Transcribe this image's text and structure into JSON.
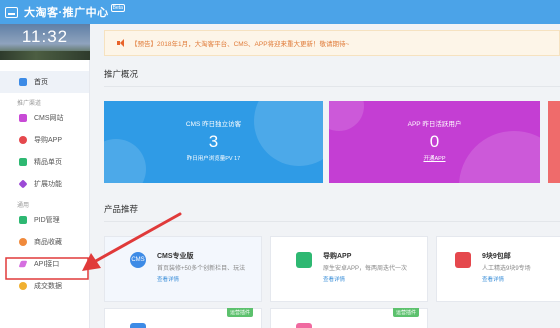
{
  "app": {
    "title": "大淘客·推广中心",
    "badge": "Beta"
  },
  "clock": "11:32",
  "sidebar": {
    "home": "首页",
    "section_promo": "推广渠道",
    "promo_items": [
      "CMS网站",
      "导购APP",
      "精品单页",
      "扩展功能"
    ],
    "section_general": "通用",
    "general_items": [
      "PID管理",
      "商品收藏",
      "API接口",
      "成交数据"
    ]
  },
  "notice": "【预告】2018年1月，大淘客平台、CMS、APP将迎来重大更新！敬请期待~",
  "overview": {
    "title": "推广概况",
    "cms": {
      "label": "CMS 昨日独立访客",
      "value": "3",
      "sub": "昨日用户浏览量PV 17"
    },
    "app": {
      "label": "APP 昨日活跃用户",
      "value": "0",
      "link": "开通APP"
    }
  },
  "products": {
    "title": "产品推荐",
    "items": [
      {
        "name": "CMS专业版",
        "desc": "首页装修+50多个创新栏目、玩法",
        "link": "查看详情",
        "icon": "CMS"
      },
      {
        "name": "导购APP",
        "desc": "原生安卓APP，每两周迭代一次",
        "link": "查看详情",
        "icon": ""
      },
      {
        "name": "9块9包邮",
        "desc": "人工精选9块9专场",
        "link": "查看详情",
        "icon": ""
      }
    ],
    "row2_badges": [
      "运营插件",
      "运营插件"
    ]
  },
  "colors": {
    "topbar": "#4ba3e8",
    "cms_card": "#2f9be6",
    "app_card": "#c43ed3",
    "notice_text": "#e07b39",
    "arrow": "#e03a3a"
  }
}
